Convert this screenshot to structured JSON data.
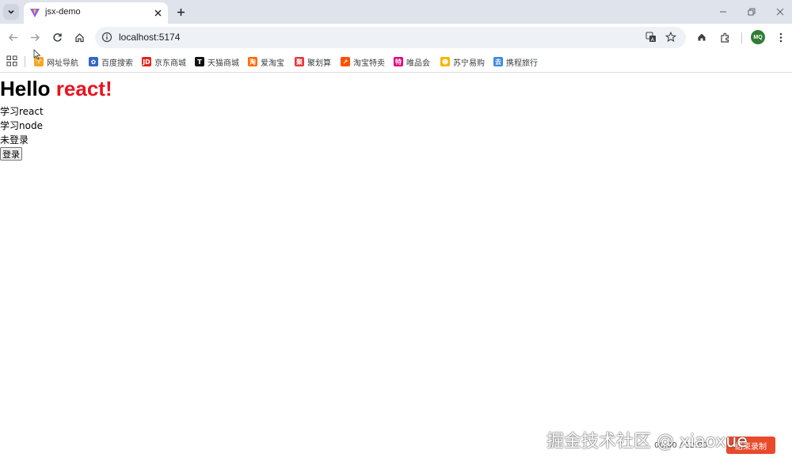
{
  "tab": {
    "title": "jsx-demo"
  },
  "omnibox": {
    "url": "localhost:5174"
  },
  "profile": {
    "initials": "MQ"
  },
  "bookmarks": [
    {
      "label": "网址导航",
      "icon": "hao123-icon",
      "color": "#f5a623",
      "glyph": "♈"
    },
    {
      "label": "百度搜索",
      "icon": "baidu-paw-icon",
      "color": "#3366cc",
      "glyph": "✿"
    },
    {
      "label": "京东商城",
      "icon": "jd-icon",
      "color": "#e1251b",
      "glyph": "JD"
    },
    {
      "label": "天猫商城",
      "icon": "tmall-icon",
      "color": "#111111",
      "glyph": "T"
    },
    {
      "label": "爱淘宝",
      "icon": "aitaobao-icon",
      "color": "#ff6a00",
      "glyph": "淘"
    },
    {
      "label": "聚划算",
      "icon": "juhuasuan-icon",
      "color": "#e4393c",
      "glyph": "聚"
    },
    {
      "label": "淘宝特卖",
      "icon": "taobao-sale-icon",
      "color": "#ff5000",
      "glyph": "↗"
    },
    {
      "label": "唯品会",
      "icon": "vip-icon",
      "color": "#e5007f",
      "glyph": "特"
    },
    {
      "label": "苏宁易购",
      "icon": "suning-icon",
      "color": "#f7b500",
      "glyph": "☻"
    },
    {
      "label": "携程旅行",
      "icon": "ctrip-icon",
      "color": "#3f8ae0",
      "glyph": "去"
    }
  ],
  "page": {
    "hello_prefix": "Hello ",
    "hello_accent": "react!",
    "items": [
      "学习react",
      "学习node"
    ],
    "status": "未登录",
    "login_label": "登录"
  },
  "overlay": {
    "watermark": "掘金技术社区 @ xiaoxue",
    "timer": "00:00 / 12:00",
    "record_label": "结束录制"
  },
  "colors": {
    "accent_red": "#e8141e",
    "tabstrip_bg": "#dfe3eb",
    "omnibox_bg": "#eef1f6"
  }
}
